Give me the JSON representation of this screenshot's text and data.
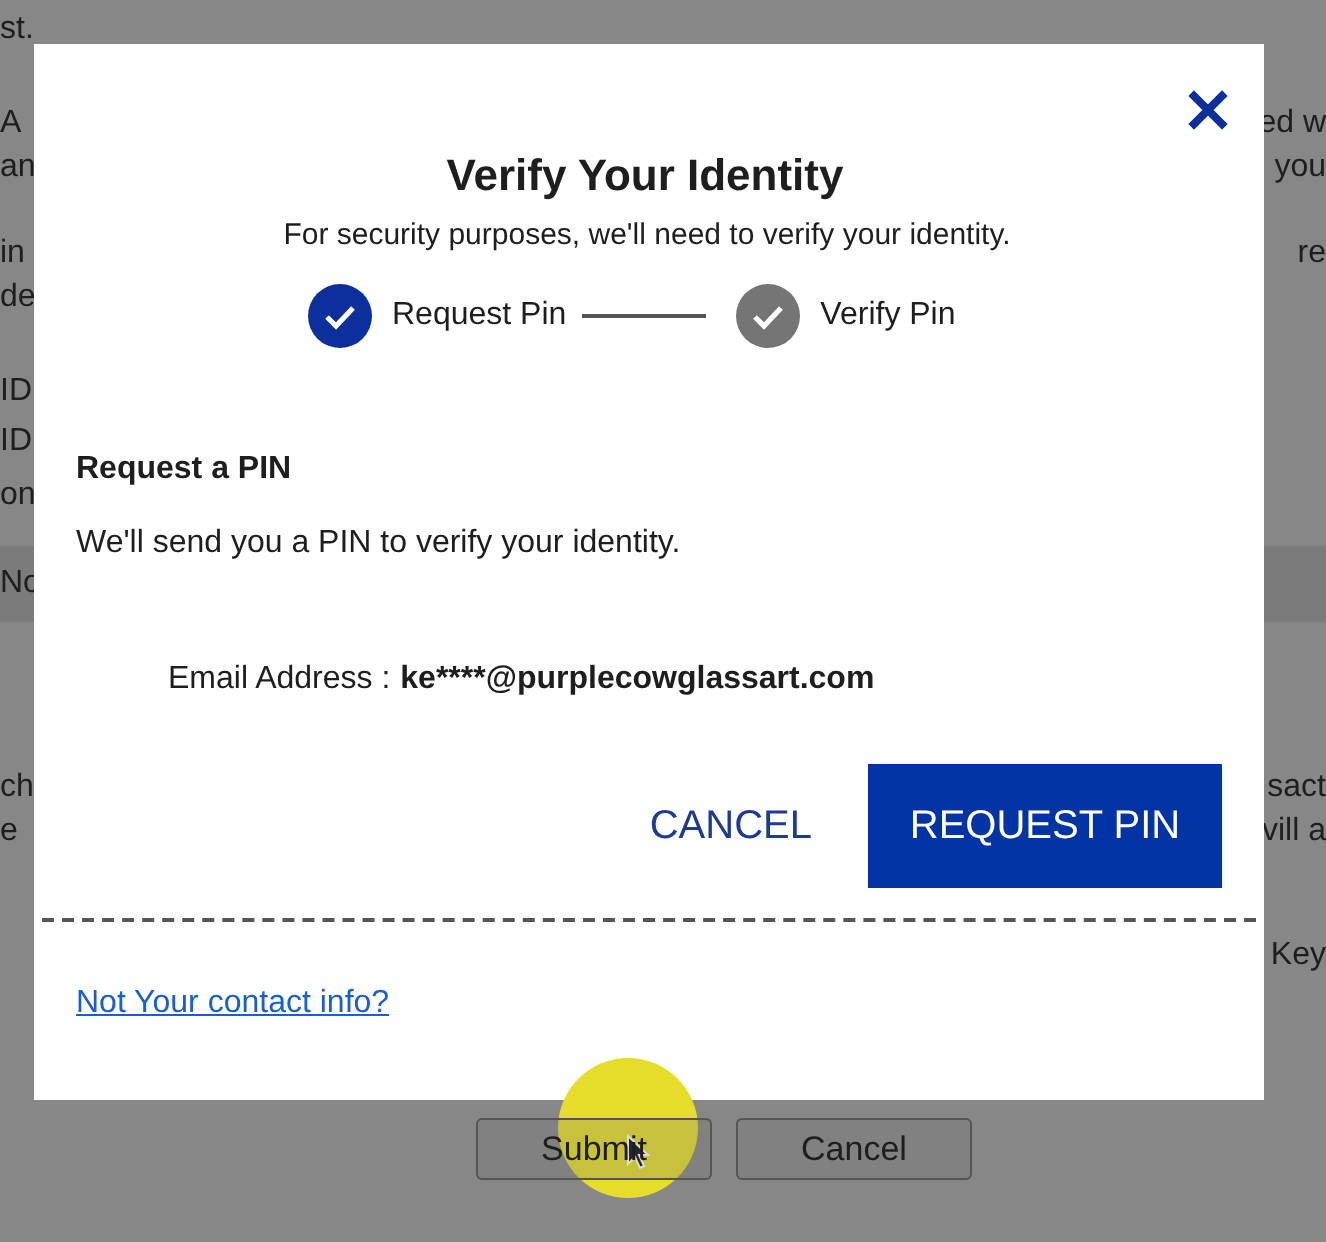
{
  "background": {
    "rows": [
      {
        "left": "st.",
        "right": ""
      },
      {
        "left": "A",
        "right": "ed w"
      },
      {
        "left": "an",
        "right": "you"
      },
      {
        "left": "in",
        "right": "re"
      },
      {
        "left": "de",
        "right": ""
      },
      {
        "left": "ID",
        "right": ""
      },
      {
        "left": "ID",
        "right": ""
      },
      {
        "left": "on",
        "right": ""
      },
      {
        "left": "No",
        "right": "",
        "kind": "band"
      },
      {
        "left": "ch",
        "right": "sact"
      },
      {
        "left": "e",
        "right": "vill a"
      },
      {
        "left": "",
        "right": "Key"
      }
    ],
    "buttons": [
      "Submit",
      "Cancel"
    ]
  },
  "dialog": {
    "title": "Verify Your Identity",
    "subtitle": "For security purposes, we'll need to verify your identity.",
    "steps": [
      {
        "label": "Request Pin",
        "selected": true
      },
      {
        "label": "Verify Pin",
        "selected": false
      }
    ],
    "section_title": "Request a PIN",
    "message": "We'll send you a PIN to verify your identity.",
    "email_label": "Email Address :",
    "email_value": "ke****@purplecowglassart.com",
    "buttons": [
      {
        "label": "CANCEL",
        "kind": "text"
      },
      {
        "label": "REQUEST PIN",
        "kind": "primary"
      }
    ],
    "link": "Not Your contact info?"
  }
}
